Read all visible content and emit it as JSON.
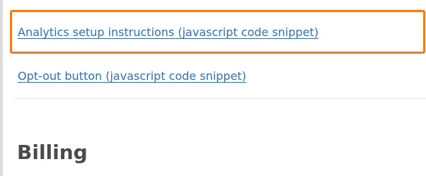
{
  "links": {
    "analytics_setup": "Analytics setup instructions (javascript code snippet)",
    "opt_out": "Opt-out button (javascript code snippet)"
  },
  "billing_section": {
    "title": "Billing"
  },
  "colors": {
    "link": "#2e6fb8",
    "highlight": "#f07c1e",
    "heading": "#4a4a4a"
  }
}
